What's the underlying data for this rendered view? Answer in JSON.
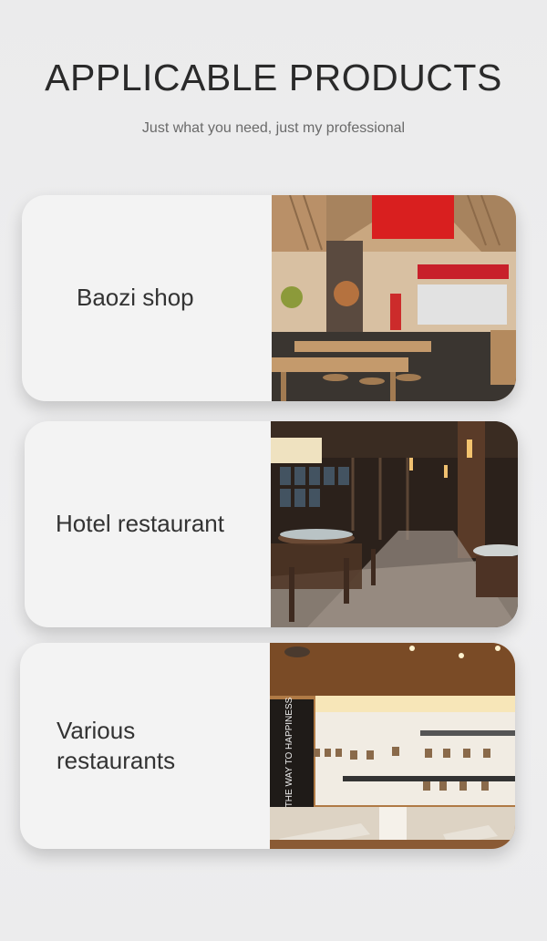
{
  "header": {
    "title": "APPLICABLE PRODUCTS",
    "subtitle": "Just what you need, just my professional"
  },
  "cards": [
    {
      "label": "Baozi shop",
      "image": "baozi-shop-interior"
    },
    {
      "label": "Hotel restaurant",
      "image": "hotel-restaurant-interior"
    },
    {
      "label": "Various restaurants",
      "image": "restaurant-interior",
      "sign_text": "THE WAY TO HAPPINESS"
    }
  ]
}
